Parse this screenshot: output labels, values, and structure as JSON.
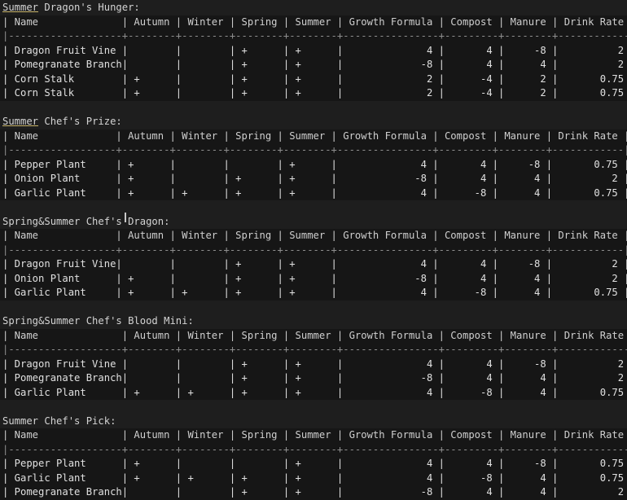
{
  "sections": [
    {
      "title_underlined": "Summer",
      "title_rest": " Dragon's Hunger:",
      "columns": [
        "Name",
        "Autumn",
        "Winter",
        "Spring",
        "Summer",
        "Growth Formula",
        "Compost",
        "Manure",
        "Drink Rate"
      ],
      "widths": [
        19,
        8,
        8,
        8,
        8,
        16,
        9,
        8,
        12
      ],
      "rows": [
        [
          "Dragon Fruit Vine",
          "",
          "",
          "+",
          "+",
          "4",
          "4",
          "-8",
          "2"
        ],
        [
          "Pomegranate Branch",
          "",
          "",
          "+",
          "+",
          "-8",
          "4",
          "4",
          "2"
        ],
        [
          "Corn Stalk",
          "+",
          "",
          "+",
          "+",
          "2",
          "-4",
          "2",
          "0.75"
        ],
        [
          "Corn Stalk",
          "+",
          "",
          "+",
          "+",
          "2",
          "-4",
          "2",
          "0.75"
        ]
      ]
    },
    {
      "title_underlined": "Summer",
      "title_rest": " Chef's Prize:",
      "columns": [
        "Name",
        "Autumn",
        "Winter",
        "Spring",
        "Summer",
        "Growth Formula",
        "Compost",
        "Manure",
        "Drink Rate"
      ],
      "widths": [
        18,
        8,
        8,
        8,
        8,
        16,
        9,
        8,
        12
      ],
      "rows": [
        [
          "Pepper Plant",
          "+",
          "",
          "",
          "+",
          "4",
          "4",
          "-8",
          "0.75"
        ],
        [
          "Onion Plant",
          "+",
          "",
          "+",
          "+",
          "-8",
          "4",
          "4",
          "2"
        ],
        [
          "Garlic Plant",
          "+",
          "+",
          "+",
          "+",
          "4",
          "-8",
          "4",
          "0.75"
        ]
      ]
    },
    {
      "title_underlined": "",
      "title_rest": "Spring&Summer Chef's Dragon:",
      "columns": [
        "Name",
        "Autumn",
        "Winter",
        "Spring",
        "Summer",
        "Growth Formula",
        "Compost",
        "Manure",
        "Drink Rate"
      ],
      "widths": [
        18,
        8,
        8,
        8,
        8,
        16,
        9,
        8,
        12
      ],
      "rows": [
        [
          "Dragon Fruit Vine",
          "",
          "",
          "+",
          "+",
          "4",
          "4",
          "-8",
          "2"
        ],
        [
          "Onion Plant",
          "+",
          "",
          "+",
          "+",
          "-8",
          "4",
          "4",
          "2"
        ],
        [
          "Garlic Plant",
          "+",
          "+",
          "+",
          "+",
          "4",
          "-8",
          "4",
          "0.75"
        ]
      ]
    },
    {
      "title_underlined": "",
      "title_rest": "Spring&Summer Chef's Blood Mini:",
      "columns": [
        "Name",
        "Autumn",
        "Winter",
        "Spring",
        "Summer",
        "Growth Formula",
        "Compost",
        "Manure",
        "Drink Rate"
      ],
      "widths": [
        19,
        8,
        8,
        8,
        8,
        16,
        9,
        8,
        12
      ],
      "rows": [
        [
          "Dragon Fruit Vine",
          "",
          "",
          "+",
          "+",
          "4",
          "4",
          "-8",
          "2"
        ],
        [
          "Pomegranate Branch",
          "",
          "",
          "+",
          "+",
          "-8",
          "4",
          "4",
          "2"
        ],
        [
          "Garlic Plant",
          "+",
          "+",
          "+",
          "+",
          "4",
          "-8",
          "4",
          "0.75"
        ]
      ]
    },
    {
      "title_underlined": "",
      "title_rest": "Summer Chef's Pick:",
      "columns": [
        "Name",
        "Autumn",
        "Winter",
        "Spring",
        "Summer",
        "Growth Formula",
        "Compost",
        "Manure",
        "Drink Rate"
      ],
      "widths": [
        19,
        8,
        8,
        8,
        8,
        16,
        9,
        8,
        12
      ],
      "rows": [
        [
          "Pepper Plant",
          "+",
          "",
          "",
          "+",
          "4",
          "4",
          "-8",
          "0.75"
        ],
        [
          "Garlic Plant",
          "+",
          "+",
          "+",
          "+",
          "4",
          "-8",
          "4",
          "0.75"
        ],
        [
          "Pomegranate Branch",
          "",
          "",
          "+",
          "+",
          "-8",
          "4",
          "4",
          "2"
        ]
      ]
    }
  ]
}
